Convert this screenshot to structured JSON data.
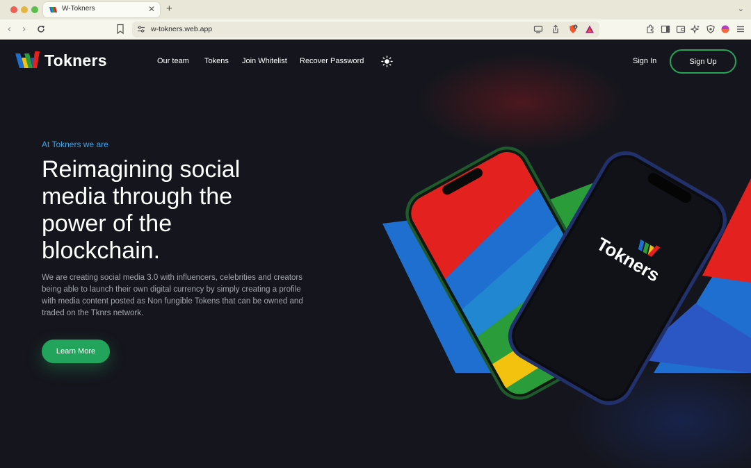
{
  "browser": {
    "tab_title": "W-Tokners",
    "tab_close": "✕",
    "new_tab": "+",
    "tab_menu": "⌄",
    "back": "‹",
    "forward": "›",
    "url": "w-tokners.web.app",
    "shield_badge": "1"
  },
  "site": {
    "logo_text": "Tokners",
    "nav": [
      "Our team",
      "Tokens",
      "Join Whitelist",
      "Recover Password"
    ],
    "sign_in": "Sign In",
    "sign_up": "Sign Up"
  },
  "hero": {
    "eyebrow": "At Tokners we are",
    "headline_lines": [
      "Reimagining social",
      "media through the",
      "power of the",
      "blockchain."
    ],
    "description": "We are creating social media 3.0 with influencers, celebrities and creators being able to launch their own digital currency by simply creating a profile with media content posted as Non fungible Tokens that can be owned and traded on the Tknrs network.",
    "cta": "Learn More",
    "phone_logo_text": "Tokners"
  },
  "colors": {
    "accent_green": "#22a45c",
    "eyebrow_blue": "#3aa3e8",
    "background": "#15161d",
    "brand_red": "#e3211f",
    "brand_blue": "#1f6fd0",
    "brand_yellow": "#f2c20f",
    "brand_green": "#2a9d3a"
  },
  "icons": {
    "theme_toggle": "sun-icon",
    "reload": "reload-icon",
    "bookmark": "bookmark-icon"
  }
}
